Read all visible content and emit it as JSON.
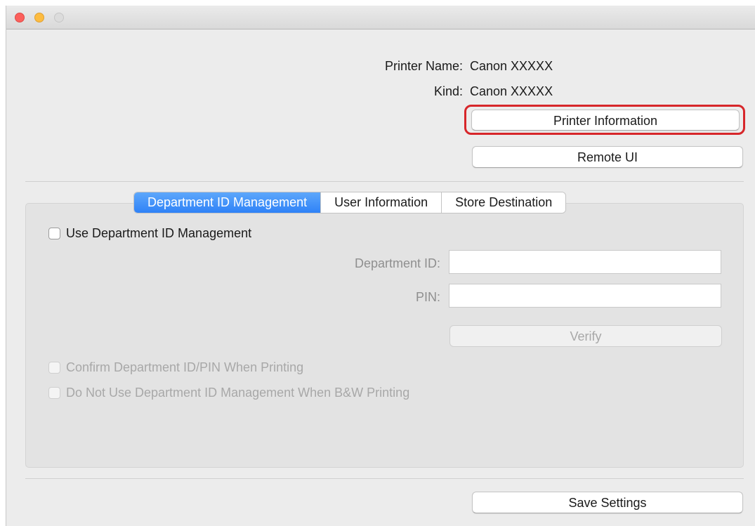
{
  "window": {
    "controls": [
      "close-icon",
      "minimize-icon",
      "zoom-icon"
    ]
  },
  "printer": {
    "name_label": "Printer Name:",
    "name_value": "Canon XXXXX",
    "kind_label": "Kind:",
    "kind_value": "Canon XXXXX"
  },
  "buttons": {
    "printer_information": "Printer Information",
    "remote_ui": "Remote UI",
    "verify": "Verify",
    "save_settings": "Save Settings"
  },
  "tabs": [
    {
      "label": "Department ID Management",
      "active": true
    },
    {
      "label": "User Information",
      "active": false
    },
    {
      "label": "Store Destination",
      "active": false
    }
  ],
  "department": {
    "use_checkbox_label": "Use Department ID Management",
    "use_checked": false,
    "department_id_label": "Department ID:",
    "department_id_value": "",
    "pin_label": "PIN:",
    "pin_value": "",
    "confirm_checkbox_label": "Confirm Department ID/PIN When Printing",
    "confirm_checked": false,
    "no_bw_checkbox_label": "Do Not Use Department ID Management When B&W Printing",
    "no_bw_checked": false
  },
  "colors": {
    "highlight": "#d7262a",
    "tab_active": "#2f82f7",
    "close": "#fc605c",
    "minimize": "#fdbc40"
  }
}
